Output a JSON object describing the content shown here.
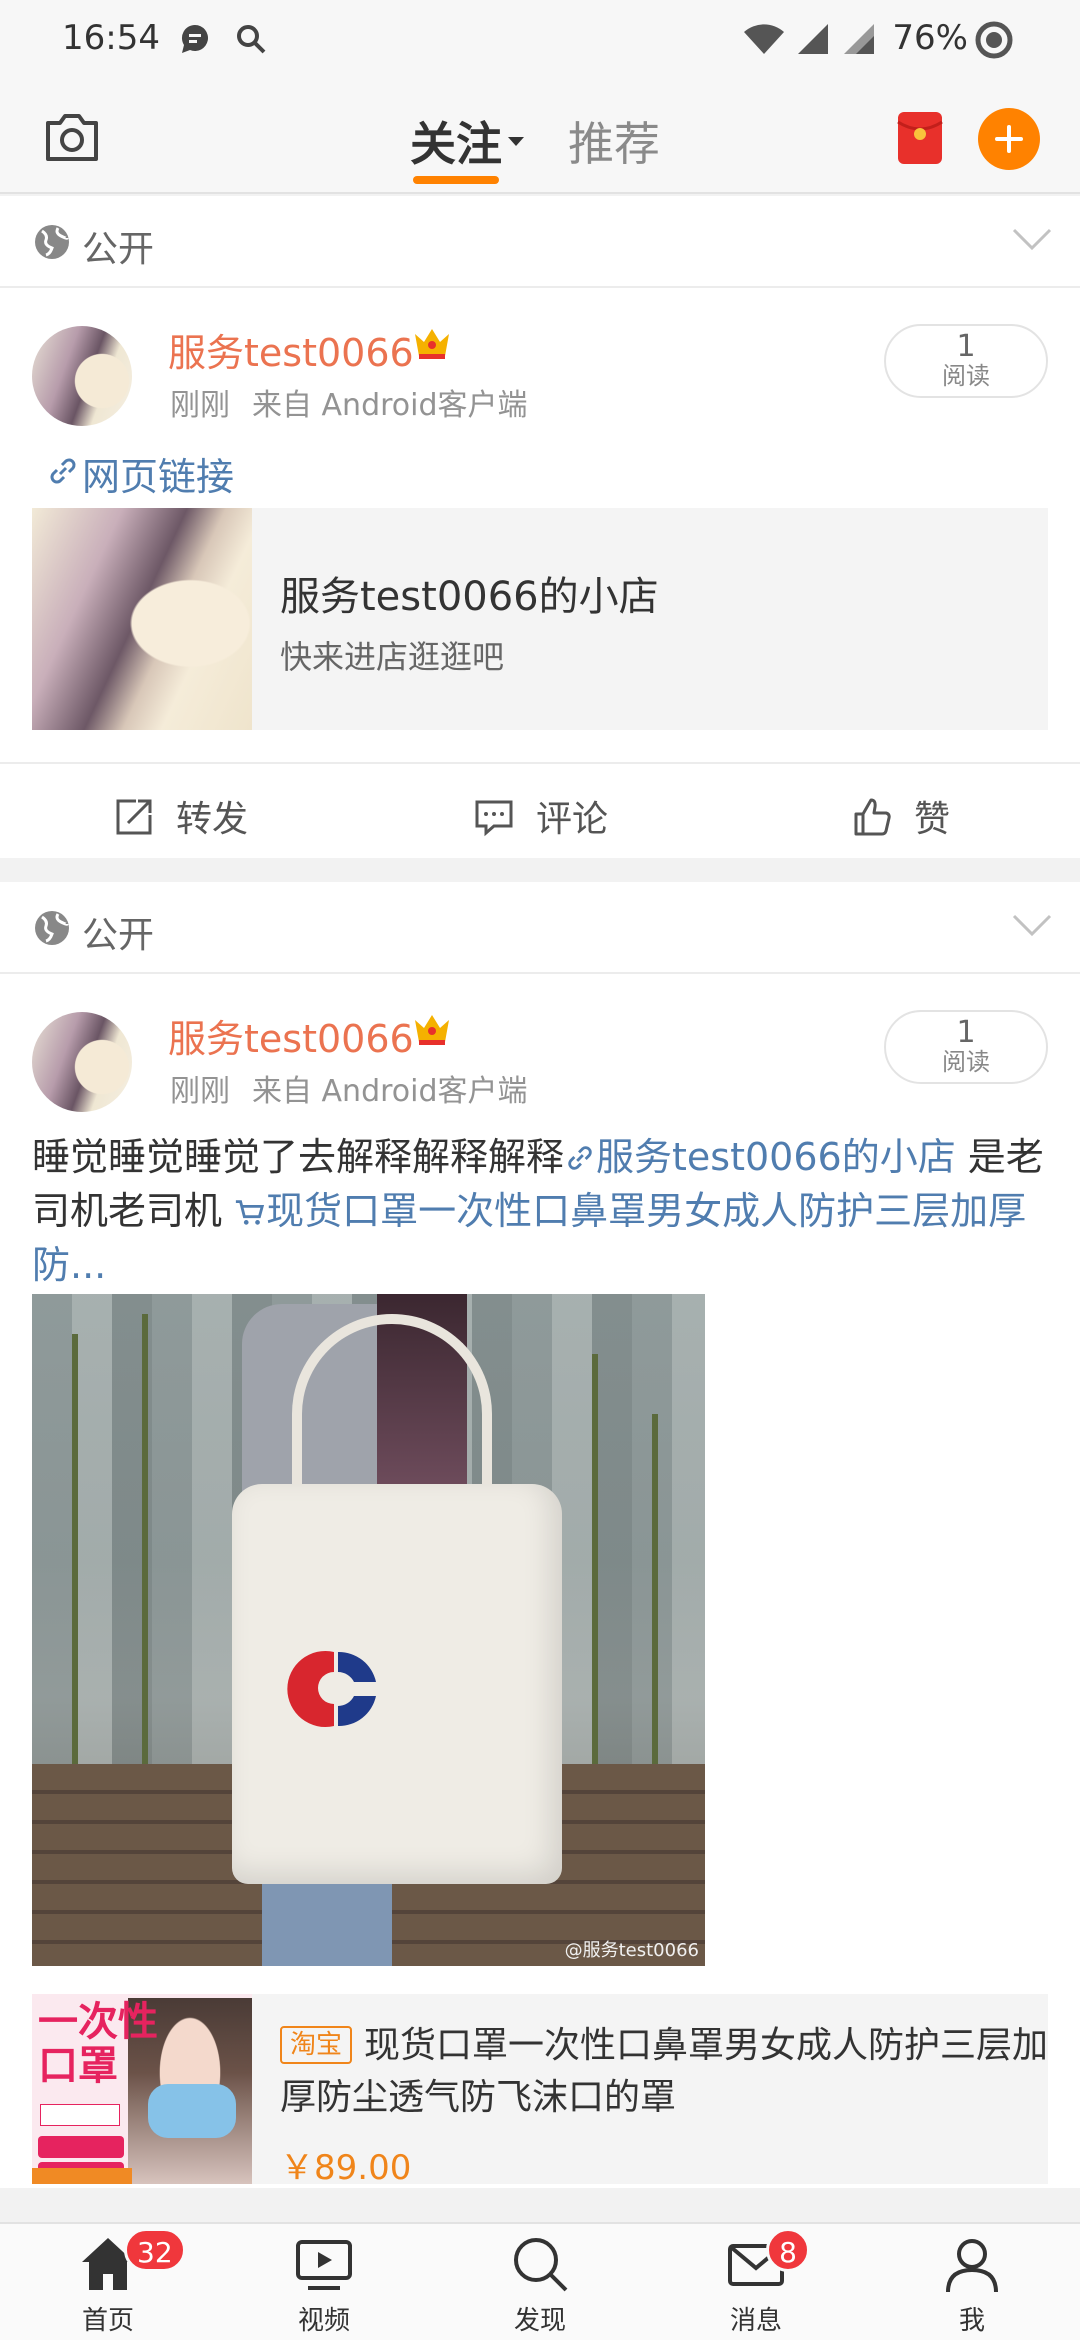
{
  "status_bar": {
    "time": "16:54",
    "battery": "76%"
  },
  "top_nav": {
    "tab_follow": "关注",
    "tab_recommend": "推荐"
  },
  "posts": [
    {
      "visibility": "公开",
      "author": "服务test0066",
      "time": "刚刚",
      "source": "来自 Android客户端",
      "read_count": "1",
      "read_label": "阅读",
      "web_link": "网页链接",
      "link_card": {
        "title": "服务test0066的小店",
        "subtitle": "快来进店逛逛吧"
      },
      "actions": {
        "repost": "转发",
        "comment": "评论",
        "like": "赞"
      }
    },
    {
      "visibility": "公开",
      "author": "服务test0066",
      "time": "刚刚",
      "source": "来自 Android客户端",
      "read_count": "1",
      "read_label": "阅读",
      "text_part1": "睡觉睡觉睡觉了去解释解释解释",
      "text_link1": "服务test0066的小店",
      "text_part2": " 是老司机老司机 ",
      "text_link2": "现货口罩一次性口鼻罩男女成人防护三层加厚防...",
      "image_watermark": "@服务test0066",
      "product": {
        "thumb_title": "一次性口罩",
        "tag": "淘宝",
        "title": "现货口罩一次性口鼻罩男女成人防护三层加厚防尘透气防飞沫口的罩",
        "price": "￥89.00"
      }
    }
  ],
  "bottom_nav": {
    "items": [
      {
        "label": "首页",
        "badge": "32"
      },
      {
        "label": "视频"
      },
      {
        "label": "发现"
      },
      {
        "label": "消息",
        "badge": "8"
      },
      {
        "label": "我"
      }
    ]
  },
  "colors": {
    "accent": "#ff8200",
    "link": "#507daf",
    "author": "#eb7350",
    "badge": "#f0373c"
  }
}
